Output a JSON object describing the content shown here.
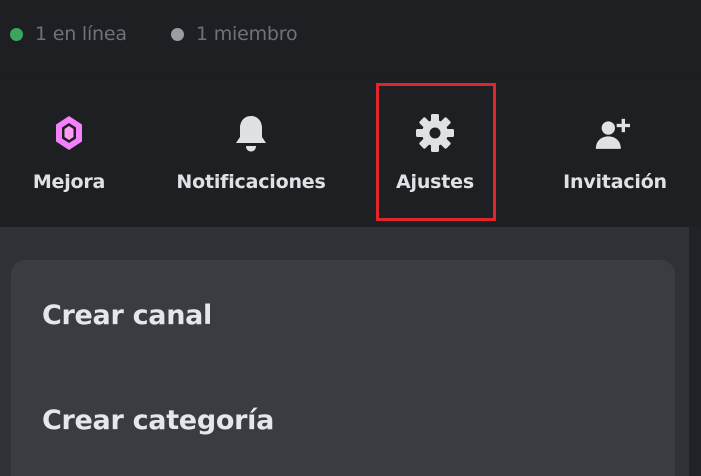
{
  "status": {
    "online_label": "1 en línea",
    "members_label": "1 miembro",
    "online_color": "#3ba55d",
    "members_color": "#9a9ca2"
  },
  "actions": [
    {
      "id": "boost",
      "label": "Mejora",
      "icon": "boost-gem-icon",
      "icon_color": "#f47fff"
    },
    {
      "id": "notifications",
      "label": "Notificaciones",
      "icon": "bell-icon",
      "icon_color": "#dfe1e5"
    },
    {
      "id": "settings",
      "label": "Ajustes",
      "icon": "gear-icon",
      "icon_color": "#dfe1e5",
      "highlighted": true
    },
    {
      "id": "invite",
      "label": "Invitación",
      "icon": "add-user-icon",
      "icon_color": "#dfe1e5"
    }
  ],
  "highlight_color": "#e0262b",
  "menu": {
    "items": [
      {
        "label": "Crear canal"
      },
      {
        "label": "Crear categoría"
      }
    ]
  }
}
